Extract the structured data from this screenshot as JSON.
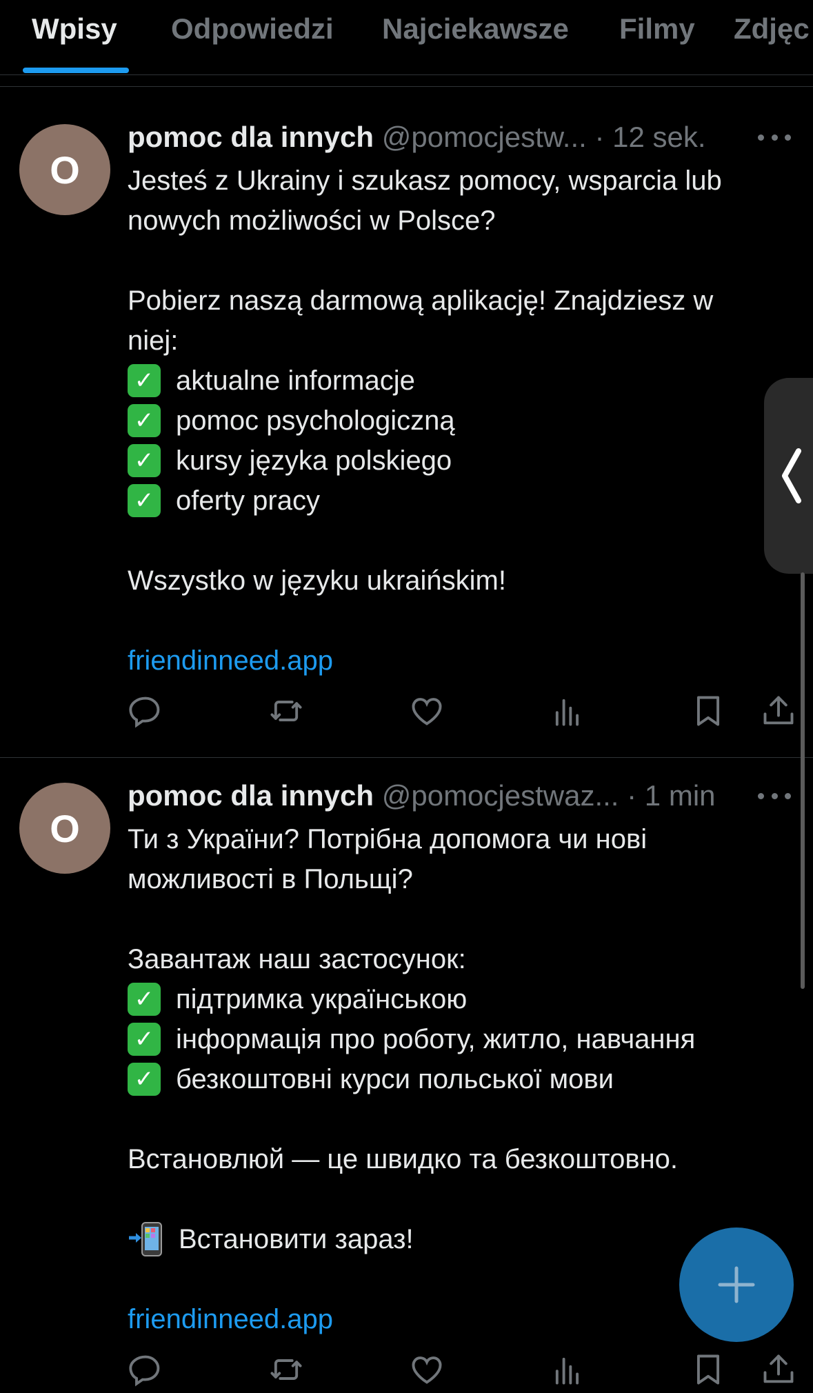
{
  "tabs": [
    {
      "label": "Wpisy",
      "active": true
    },
    {
      "label": "Odpowiedzi",
      "active": false
    },
    {
      "label": "Najciekawsze",
      "active": false
    },
    {
      "label": "Filmy",
      "active": false
    },
    {
      "label": "Zdjęc",
      "active": false
    }
  ],
  "posts": [
    {
      "avatar_letter": "O",
      "name": "pomoc dla innych",
      "handle": "@pomocjestw...",
      "time": "· 12 sek.",
      "lines": [
        "Jesteś z Ukrainy i szukasz pomocy, wsparcia lub",
        "nowych możliwości w Polsce?",
        "",
        "Pobierz naszą darmową aplikację! Znajdziesz w",
        "niej:",
        "aktualne informacje",
        "pomoc psychologiczną",
        "kursy języka polskiego",
        "oferty pracy",
        "",
        "Wszystko w języku ukraińskim!",
        "",
        "friendinneed.app"
      ]
    },
    {
      "avatar_letter": "O",
      "name": "pomoc dla innych",
      "handle": "@pomocjestwaz...",
      "time": "· 1 min",
      "lines": [
        "Ти з України? Потрібна допомога чи нові",
        "можливості в Польщі?",
        "",
        "Завантаж наш застосунок:",
        "підтримка українською",
        "інформація про роботу, житло, навчання",
        "безкоштовні курси польської мови",
        "",
        "Встановлюй — це швидко та безкоштовно.",
        "",
        "Встановити зараз!",
        "",
        "friendinneed.app"
      ]
    }
  ],
  "icons": {
    "reply": "reply-icon",
    "repost": "repost-icon",
    "like": "like-icon",
    "views": "views-icon",
    "bookmark": "bookmark-icon",
    "share": "share-icon",
    "compose": "plus-icon",
    "side_handle": "chevron-left-icon",
    "checkmark": "check-mark-button-emoji",
    "phone": "mobile-phone-arrow-emoji"
  },
  "colors": {
    "background": "#000000",
    "text": "#e7e9ea",
    "muted": "#71767b",
    "accent": "#1d9bf0",
    "fab": "#1a6ea8",
    "avatar": "#8c7367",
    "check": "#31b545"
  }
}
